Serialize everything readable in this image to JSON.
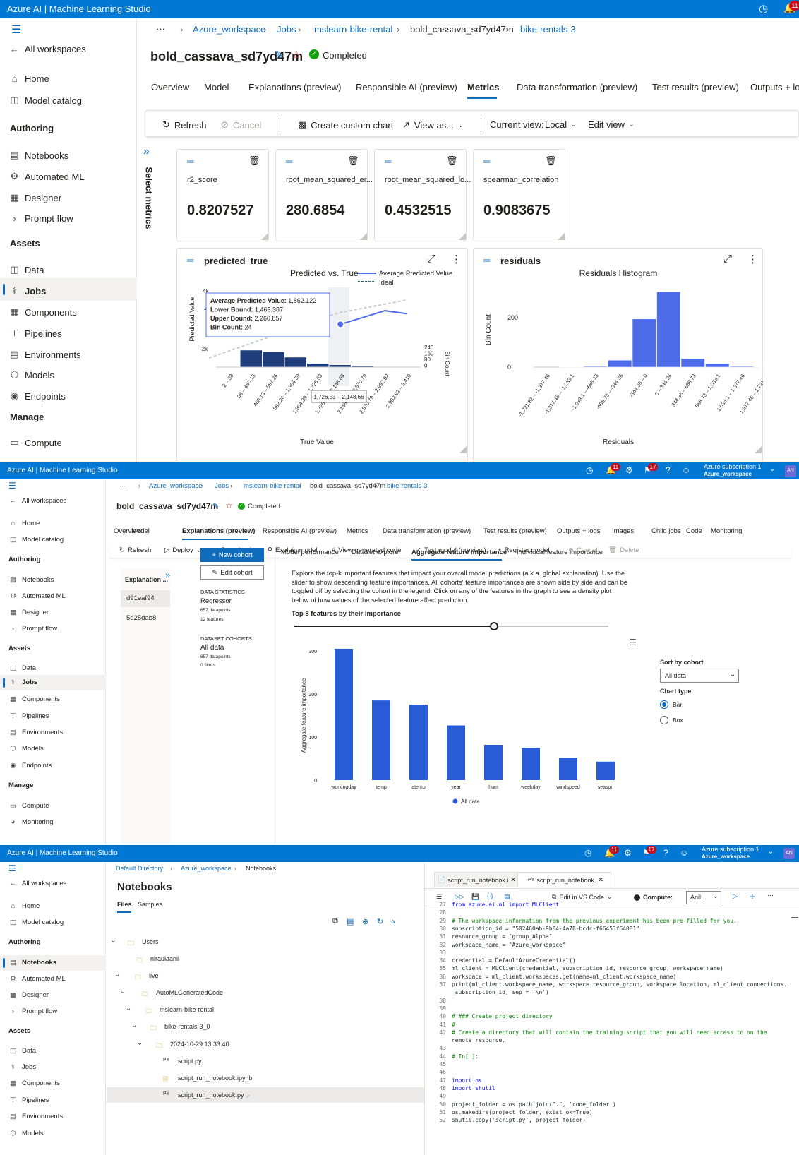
{
  "app_title": "Azure AI | Machine Learning Studio",
  "colors": {
    "brand": "#0078d4",
    "accent": "#0f6cbd",
    "bar": "#2a5bd7",
    "pred_bar": "#1f3d7a",
    "hist_bar": "#4e6bea",
    "completed": "#13a10e"
  },
  "header": {
    "subscription": "Azure subscription 1",
    "workspace": "Azure_workspace",
    "avatar": "AN",
    "notif1": "11",
    "notif2": "17"
  },
  "sidebar": {
    "all_workspaces": "All workspaces",
    "home": "Home",
    "model_catalog": "Model catalog",
    "authoring": "Authoring",
    "notebooks": "Notebooks",
    "automated_ml": "Automated ML",
    "designer": "Designer",
    "prompt_flow": "Prompt flow",
    "assets": "Assets",
    "data": "Data",
    "jobs": "Jobs",
    "components": "Components",
    "pipelines": "Pipelines",
    "environments": "Environments",
    "models": "Models",
    "endpoints": "Endpoints",
    "manage": "Manage",
    "compute": "Compute",
    "monitoring": "Monitoring"
  },
  "panel1": {
    "breadcrumb": [
      "Azure_workspace",
      "Jobs",
      "mslearn-bike-rental",
      "bold_cassava_sd7yd47m",
      "bike-rentals-3"
    ],
    "job_name": "bold_cassava_sd7yd47m",
    "status": "Completed",
    "tabs": [
      "Overview",
      "Model",
      "Explanations (preview)",
      "Responsible AI (preview)",
      "Metrics",
      "Data transformation (preview)",
      "Test results (preview)",
      "Outputs + lo"
    ],
    "toolbar": {
      "refresh": "Refresh",
      "cancel": "Cancel",
      "custom_chart": "Create custom chart",
      "view_as": "View as...",
      "current_view_label": "Current view:",
      "current_view": "Local",
      "edit_view": "Edit view"
    },
    "select_metrics": "Select metrics",
    "metrics": [
      {
        "name": "r2_score",
        "value": "0.8207527"
      },
      {
        "name": "root_mean_squared_er...",
        "value": "280.6854"
      },
      {
        "name": "root_mean_squared_lo...",
        "value": "0.4532515"
      },
      {
        "name": "spearman_correlation",
        "value": "0.9083675"
      }
    ],
    "pred_card": {
      "title": "predicted_true",
      "chart_title": "Predicted vs. True",
      "legend_avg": "Average Predicted Value",
      "legend_ideal": "Ideal",
      "ylabel": "Predicted Value",
      "xlabel": "True Value",
      "bincount_label": "Bin Count",
      "ytick_top": "4k",
      "ytick_2": "2",
      "ytick_neg": "-2k",
      "bin_ticks": [
        "240",
        "160",
        "80",
        "0"
      ],
      "tooltip": {
        "avg_label": "Average Predicted Value:",
        "avg": "1,862.122",
        "lb_label": "Lower Bound:",
        "lb": "1,463.387",
        "ub_label": "Upper Bound:",
        "ub": "2,260.857",
        "bc_label": "Bin Count:",
        "bc": "24"
      },
      "x_tooltip": "1,726.53 – 2,148.66"
    },
    "res_card": {
      "title": "residuals",
      "chart_title": "Residuals Histogram",
      "ylabel": "Bin Count",
      "xlabel": "Residuals",
      "ytick_200": "200",
      "ytick_0": "0"
    }
  },
  "panel2": {
    "breadcrumb": [
      "Azure_workspace",
      "Jobs",
      "mslearn-bike-rental",
      "bold_cassava_sd7yd47m",
      "bike-rentals-3"
    ],
    "job_name": "bold_cassava_sd7yd47m",
    "status": "Completed",
    "tabs": [
      "Overview",
      "Model",
      "Explanations (preview)",
      "Responsible AI (preview)",
      "Metrics",
      "Data transformation (preview)",
      "Test results (preview)",
      "Outputs + logs",
      "Images",
      "Child jobs",
      "Code",
      "Monitoring"
    ],
    "toolbar": [
      "Refresh",
      "Deploy",
      "Download",
      "Explain model",
      "View generated code",
      "Test model (preview)",
      "Register model",
      "Cancel",
      "Delete"
    ],
    "explanation_header": "Explanation ...",
    "explanations": [
      "d91eaf94",
      "5d25dab8"
    ],
    "new_cohort": "New cohort",
    "edit_cohort": "Edit cohort",
    "data_stats": {
      "label": "DATA STATISTICS",
      "type": "Regressor",
      "datapoints": "657 datapoints",
      "features": "12 features"
    },
    "cohorts": {
      "label": "DATASET COHORTS",
      "name": "All data",
      "datapoints": "657 datapoints",
      "filters": "0 filters"
    },
    "subtabs": [
      "Model performance",
      "Dataset explorer",
      "Aggregate feature importance",
      "Individual feature importance"
    ],
    "description": "Explore the top-k important features that impact your overall model predictions (a.k.a. global explanation). Use the slider to show descending feature importances. All cohorts' feature importances are shown side by side and can be toggled off by selecting the cohort in the legend. Click on any of the features in the graph to see a density plot below of how values of the selected feature affect prediction.",
    "slider_label": "Top 8 features by their importance",
    "slider_value": 8,
    "sort_label": "Sort by cohort",
    "sort_value": "All data",
    "chart_type_label": "Chart type",
    "chart_types": [
      "Bar",
      "Box"
    ]
  },
  "chart_data": [
    {
      "type": "bar",
      "title": "",
      "xlabel": "",
      "ylabel": "Aggregate feature importance",
      "categories": [
        "workingday",
        "temp",
        "atemp",
        "year",
        "hum",
        "weekday",
        "windspeed",
        "season"
      ],
      "series": [
        {
          "name": "All data",
          "values": [
            305,
            185,
            175,
            127,
            82,
            75,
            52,
            43
          ]
        }
      ],
      "ylim": [
        0,
        300
      ],
      "yticks": [
        0,
        100,
        200,
        300
      ],
      "legend": "bottom"
    },
    {
      "type": "bar",
      "title": "Residuals Histogram",
      "xlabel": "Residuals",
      "ylabel": "Bin Count",
      "categories": [
        "-1,721.82 – -1,377.46",
        "-1,377.46 – -1,033.1",
        "-1,033.1 – -688.73",
        "-688.73 – -344.36",
        "-344.36 – 0",
        "0 – 344.36",
        "344.36 – 688.73",
        "688.73 – 1,033.1",
        "1,033.1 – 1,377.46",
        "1,377.46 – 1,721.82"
      ],
      "values": [
        0,
        1,
        3,
        28,
        195,
        305,
        35,
        15,
        3,
        1
      ],
      "ylim": [
        0,
        320
      ],
      "yticks": [
        0,
        200
      ]
    },
    {
      "type": "line",
      "title": "Predicted vs. True",
      "xlabel": "True Value",
      "ylabel": "Predicted Value",
      "categories": [
        "2 – 38",
        "38 – 460.13",
        "460.13 – 882.26",
        "882.26 – 1,304.39",
        "1,304.39 – 1,726.53",
        "1,726.53 – 2,148.66",
        "2,148.66 – 2,570.79",
        "2,570.79 – 2,992.92",
        "2,992.92 – 3,410"
      ],
      "series": [
        {
          "name": "Average Predicted Value",
          "values": [
            null,
            null,
            null,
            null,
            null,
            1862.122,
            2300,
            2750,
            2550
          ]
        },
        {
          "name": "Bin Count",
          "values": [
            0,
            190,
            170,
            110,
            40,
            24,
            12,
            3,
            0
          ]
        }
      ],
      "ylim": [
        -2000,
        4000
      ]
    }
  ],
  "panel3": {
    "breadcrumb": [
      "Default Directory",
      "Azure_workspace",
      "Notebooks"
    ],
    "title": "Notebooks",
    "tabs": [
      "Files",
      "Samples"
    ],
    "tree": [
      "Users",
      "niraulaanil",
      "live",
      "AutoMLGeneratedCode",
      "mslearn-bike-rental",
      "bike-rentals-3_0",
      "2024-10-29 13.33.40",
      "script.py",
      "script_run_notebook.ipynb",
      "script_run_notebook.py"
    ],
    "editor_tabs": [
      "script_run_notebook.i",
      "script_run_notebook."
    ],
    "edit_in_vscode": "Edit in VS Code",
    "compute_label": "Compute:",
    "compute_value": "Anil...",
    "code": [
      {
        "n": "27",
        "t": "from azure.ai.ml import MLClient"
      },
      {
        "n": "28",
        "t": ""
      },
      {
        "n": "29",
        "t": "# The workspace information from the previous experiment has been pre-filled for you."
      },
      {
        "n": "30",
        "t": "subscription_id = \"502460ab-9b04-4a78-bcdc-f66453f64081\""
      },
      {
        "n": "31",
        "t": "resource_group = \"group_Alpha\""
      },
      {
        "n": "32",
        "t": "workspace_name = \"Azure_workspace\""
      },
      {
        "n": "33",
        "t": ""
      },
      {
        "n": "34",
        "t": "credential = DefaultAzureCredential()"
      },
      {
        "n": "35",
        "t": "ml_client = MLClient(credential, subscription_id, resource_group, workspace_name)"
      },
      {
        "n": "36",
        "t": "workspace = ml_client.workspaces.get(name=ml_client.workspace_name)"
      },
      {
        "n": "37",
        "t": "print(ml_client.workspace_name, workspace.resource_group, workspace.location, ml_client.connections."
      },
      {
        "n": "",
        "t": "_subscription_id, sep = '\\n')"
      },
      {
        "n": "38",
        "t": ""
      },
      {
        "n": "39",
        "t": ""
      },
      {
        "n": "40",
        "t": "# ### Create project directory"
      },
      {
        "n": "41",
        "t": "#"
      },
      {
        "n": "42",
        "t": "# Create a directory that will contain the training script that you will need access to on the"
      },
      {
        "n": "",
        "t": "remote resource."
      },
      {
        "n": "43",
        "t": ""
      },
      {
        "n": "44",
        "t": "# In[ ]:"
      },
      {
        "n": "45",
        "t": ""
      },
      {
        "n": "46",
        "t": ""
      },
      {
        "n": "47",
        "t": "import os"
      },
      {
        "n": "48",
        "t": "import shutil"
      },
      {
        "n": "49",
        "t": ""
      },
      {
        "n": "50",
        "t": "project_folder = os.path.join(\".\", 'code_folder')"
      },
      {
        "n": "51",
        "t": "os.makedirs(project_folder, exist_ok=True)"
      },
      {
        "n": "52",
        "t": "shutil.copy('script.py', project_folder)"
      }
    ]
  }
}
